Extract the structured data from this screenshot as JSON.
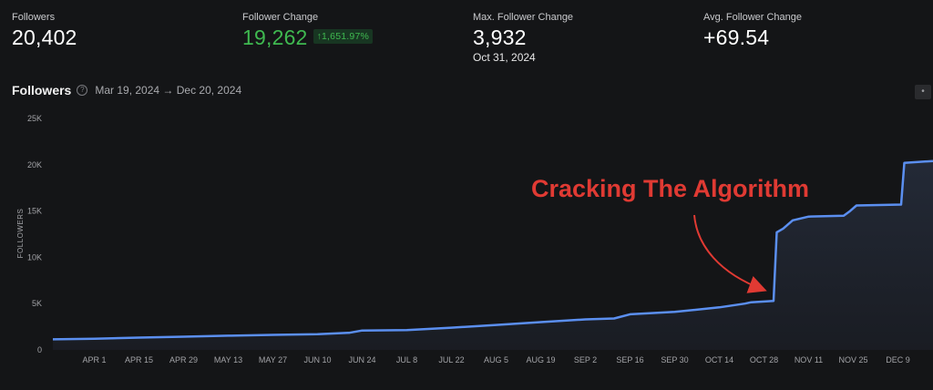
{
  "stats": {
    "followers": {
      "label": "Followers",
      "value": "20,402"
    },
    "change": {
      "label": "Follower Change",
      "value": "19,262",
      "badge": "↑1,651.97%"
    },
    "max_change": {
      "label": "Max. Follower Change",
      "value": "3,932",
      "date": "Oct 31, 2024"
    },
    "avg_change": {
      "label": "Avg. Follower Change",
      "value": "+69.54"
    }
  },
  "chart_header": {
    "title": "Followers",
    "date_range": "Mar 19, 2024 → Dec 20, 2024",
    "help_icon": "question-circle-icon",
    "menu_icon": "dot-menu-icon"
  },
  "annotation": {
    "text": "Cracking The Algorithm",
    "color": "#e03a33"
  },
  "colors": {
    "line": "#5b8ff0",
    "fill": "#1e2430",
    "background": "#141517",
    "accent_green": "#3fb950"
  },
  "chart_data": {
    "type": "area",
    "title": "Followers",
    "ylabel": "FOLLOWERS",
    "xlabel": "",
    "ylim": [
      0,
      25000
    ],
    "yticks": [
      0,
      5000,
      10000,
      15000,
      20000,
      25000
    ],
    "ytick_labels": [
      "0",
      "5K",
      "10K",
      "15K",
      "20K",
      "25K"
    ],
    "xlim": [
      "2024-03-19",
      "2024-12-20"
    ],
    "xticks": [
      {
        "date": "2024-04-01",
        "label": "APR 1"
      },
      {
        "date": "2024-04-15",
        "label": "APR 15"
      },
      {
        "date": "2024-04-29",
        "label": "APR 29"
      },
      {
        "date": "2024-05-13",
        "label": "MAY 13"
      },
      {
        "date": "2024-05-27",
        "label": "MAY 27"
      },
      {
        "date": "2024-06-10",
        "label": "JUN 10"
      },
      {
        "date": "2024-06-24",
        "label": "JUN 24"
      },
      {
        "date": "2024-07-08",
        "label": "JUL 8"
      },
      {
        "date": "2024-07-22",
        "label": "JUL 22"
      },
      {
        "date": "2024-08-05",
        "label": "AUG 5"
      },
      {
        "date": "2024-08-19",
        "label": "AUG 19"
      },
      {
        "date": "2024-09-02",
        "label": "SEP 2"
      },
      {
        "date": "2024-09-16",
        "label": "SEP 16"
      },
      {
        "date": "2024-09-30",
        "label": "SEP 30"
      },
      {
        "date": "2024-10-14",
        "label": "OCT 14"
      },
      {
        "date": "2024-10-28",
        "label": "OCT 28"
      },
      {
        "date": "2024-11-11",
        "label": "NOV 11"
      },
      {
        "date": "2024-11-25",
        "label": "NOV 25"
      },
      {
        "date": "2024-12-09",
        "label": "DEC 9"
      }
    ],
    "grid": false,
    "series": [
      {
        "points": [
          [
            "2024-03-19",
            1140
          ],
          [
            "2024-04-01",
            1200
          ],
          [
            "2024-04-15",
            1330
          ],
          [
            "2024-04-29",
            1430
          ],
          [
            "2024-05-13",
            1540
          ],
          [
            "2024-05-27",
            1620
          ],
          [
            "2024-06-10",
            1700
          ],
          [
            "2024-06-20",
            1850
          ],
          [
            "2024-06-24",
            2100
          ],
          [
            "2024-07-08",
            2150
          ],
          [
            "2024-07-22",
            2400
          ],
          [
            "2024-08-05",
            2700
          ],
          [
            "2024-08-19",
            3000
          ],
          [
            "2024-09-02",
            3300
          ],
          [
            "2024-09-11",
            3400
          ],
          [
            "2024-09-16",
            3850
          ],
          [
            "2024-09-30",
            4100
          ],
          [
            "2024-10-14",
            4600
          ],
          [
            "2024-10-22",
            5000
          ],
          [
            "2024-10-24",
            5150
          ],
          [
            "2024-10-31",
            5300
          ],
          [
            "2024-11-01",
            12700
          ],
          [
            "2024-11-03",
            13100
          ],
          [
            "2024-11-06",
            14000
          ],
          [
            "2024-11-11",
            14400
          ],
          [
            "2024-11-22",
            14500
          ],
          [
            "2024-11-24",
            15000
          ],
          [
            "2024-11-26",
            15600
          ],
          [
            "2024-12-10",
            15700
          ],
          [
            "2024-12-11",
            20200
          ],
          [
            "2024-12-20",
            20402
          ]
        ]
      }
    ]
  }
}
